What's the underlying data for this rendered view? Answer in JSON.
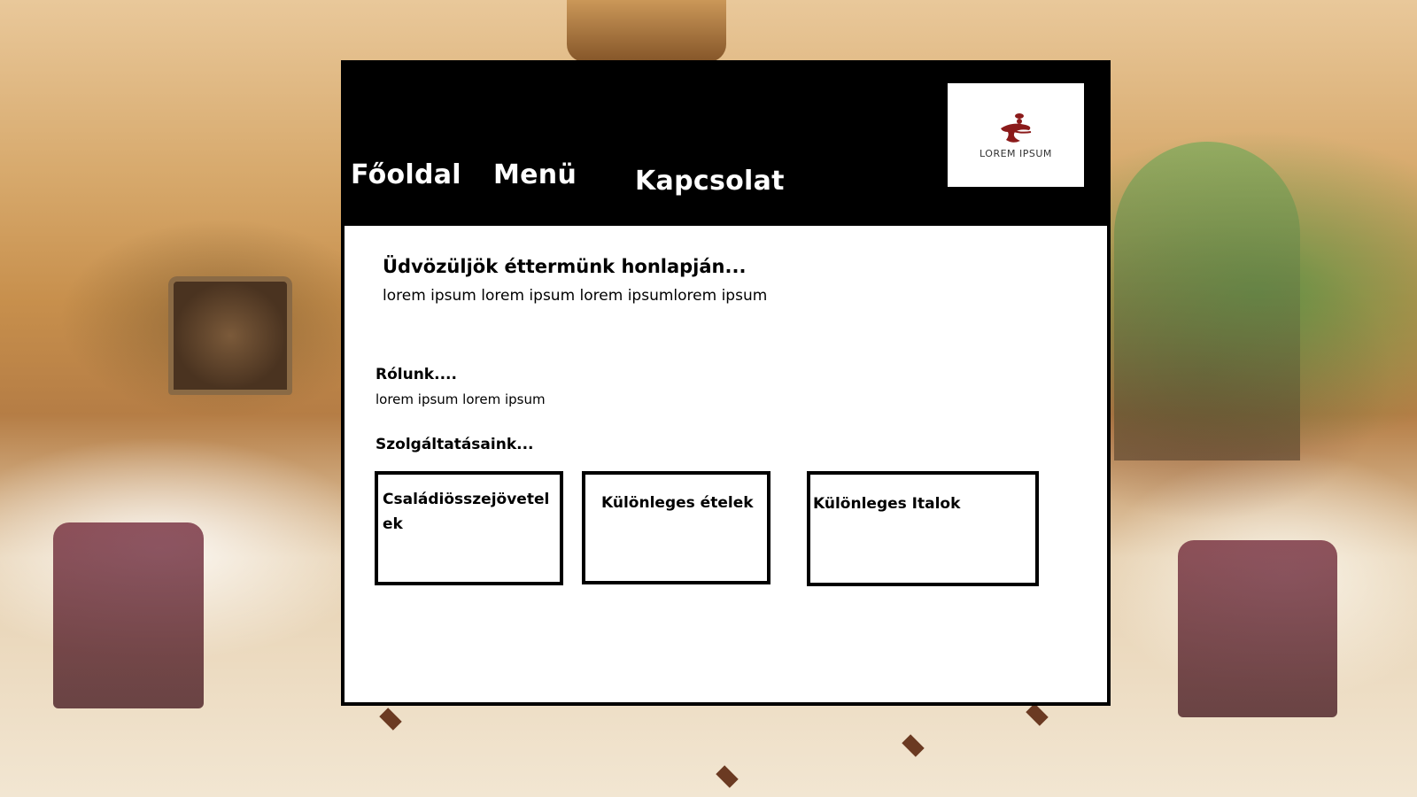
{
  "nav": {
    "items": [
      {
        "label": "Főoldal"
      },
      {
        "label": "Menü"
      },
      {
        "label": "Kapcsolat"
      }
    ]
  },
  "logo": {
    "text": "LOREM IPSUM",
    "icon": "chef-logo-icon",
    "color": "#8b1a1a"
  },
  "welcome": {
    "title": "Üdvözüljök éttermünk honlapján...",
    "text": "lorem ipsum lorem ipsum lorem ipsumlorem ipsum"
  },
  "about": {
    "title": "Rólunk....",
    "text": "lorem ipsum lorem ipsum"
  },
  "services": {
    "title": "Szolgáltatásaink...",
    "items": [
      {
        "label": "Családiösszejövetelek"
      },
      {
        "label": "Különleges ételek"
      },
      {
        "label": "Különleges Italok"
      }
    ]
  },
  "colors": {
    "header_bg": "#000000",
    "content_bg": "#ffffff",
    "text": "#000000"
  }
}
